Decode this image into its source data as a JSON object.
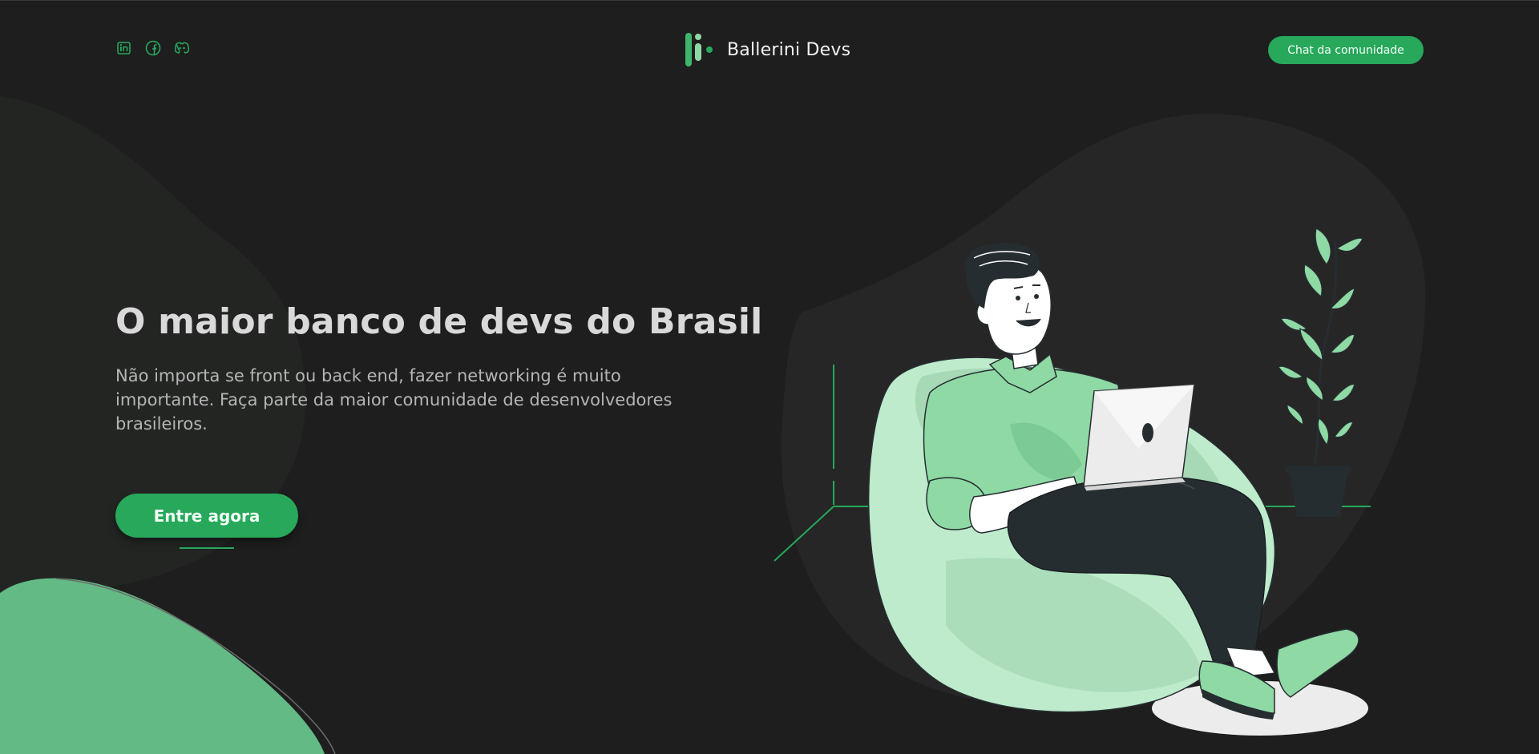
{
  "header": {
    "social": [
      {
        "name": "linkedin-icon"
      },
      {
        "name": "facebook-icon"
      },
      {
        "name": "discord-icon"
      }
    ],
    "brand_name": "Ballerini Devs",
    "community_button": "Chat da comunidade"
  },
  "hero": {
    "title": "O maior banco de devs do Brasil",
    "subtitle": "Não importa se front ou back end, fazer networking é muito importante. Faça parte da maior comunidade de desenvolvedores brasileiros.",
    "cta": "Entre agora"
  },
  "colors": {
    "background": "#1e1e1e",
    "accent": "#27a85b",
    "light_green": "#8ed9a4",
    "pale_green": "#bdebcc",
    "blob": "#262626"
  }
}
